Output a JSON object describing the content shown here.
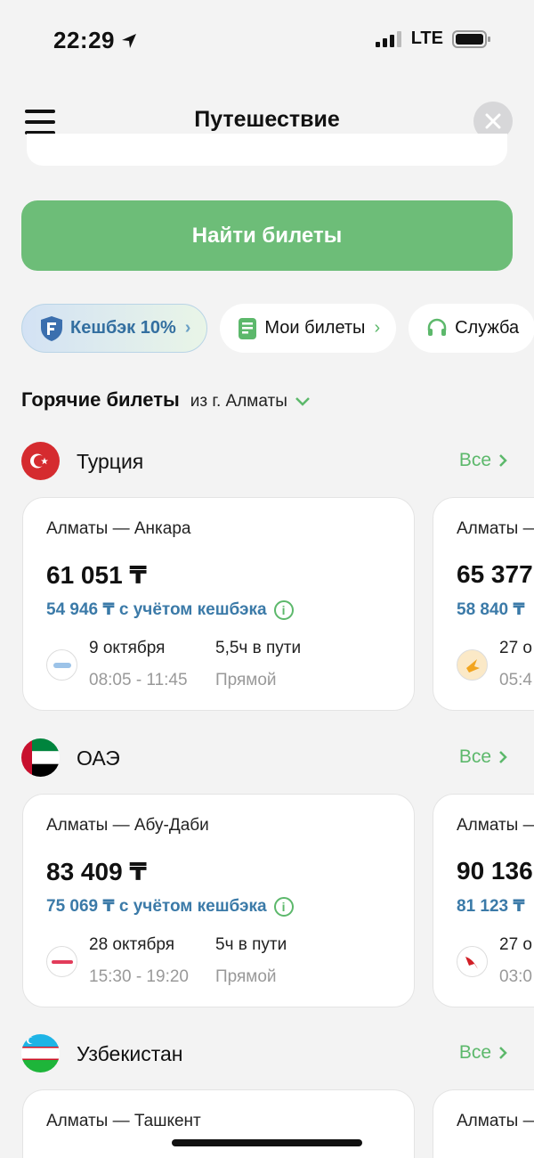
{
  "status": {
    "time": "22:29",
    "network": "LTE"
  },
  "header": {
    "title": "Путешествие"
  },
  "find_button": "Найти билеты",
  "chips": [
    {
      "label": "Кешбэк 10%"
    },
    {
      "label": "Мои билеты"
    },
    {
      "label": "Служба"
    }
  ],
  "hot": {
    "title": "Горячие билеты",
    "from": "из г. Алматы"
  },
  "all_label": "Все",
  "sections": [
    {
      "country": "Турция",
      "cards": [
        {
          "route": "Алматы — Анкара",
          "price": "61 051 ₸",
          "cashback": "54 946 ₸ с учётом кешбэка",
          "date": "9 октября",
          "time": "08:05 - 11:45",
          "duration": "5,5ч в пути",
          "type": "Прямой"
        },
        {
          "route": "Алматы — ",
          "price": "65 377",
          "cashback": "58 840 ₸",
          "date": "27 о",
          "time": "05:4"
        }
      ]
    },
    {
      "country": "ОАЭ",
      "cards": [
        {
          "route": "Алматы — Абу-Даби",
          "price": "83 409 ₸",
          "cashback": "75 069 ₸ с учётом кешбэка",
          "date": "28 октября",
          "time": "15:30 - 19:20",
          "duration": "5ч в пути",
          "type": "Прямой"
        },
        {
          "route": "Алматы — ",
          "price": "90 136",
          "cashback": "81 123 ₸",
          "date": "27 о",
          "time": "03:0"
        }
      ]
    },
    {
      "country": "Узбекистан",
      "cards": [
        {
          "route": "Алматы — Ташкент"
        },
        {
          "route": "Алматы — "
        }
      ]
    }
  ],
  "colors": {
    "accent_green": "#6dbd78",
    "link_green": "#5cb86b",
    "cashback_blue": "#3b7aa8"
  }
}
